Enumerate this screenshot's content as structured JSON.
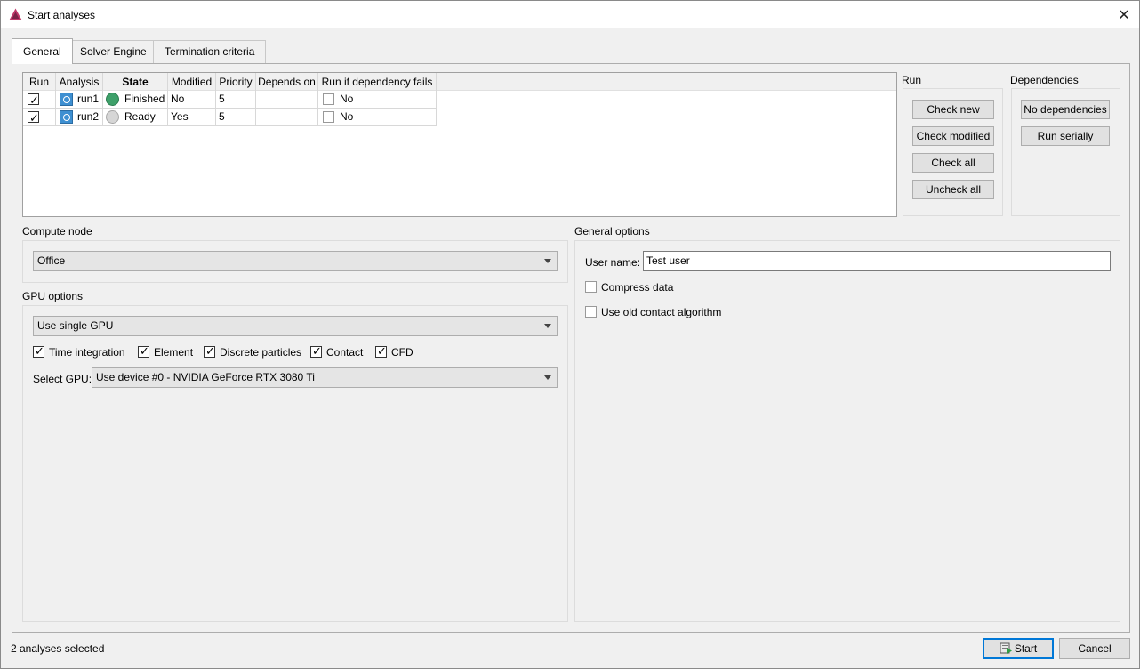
{
  "window": {
    "title": "Start analyses",
    "close_glyph": "✕"
  },
  "tabs": [
    {
      "label": "General",
      "active": true
    },
    {
      "label": "Solver Engine",
      "active": false
    },
    {
      "label": "Termination criteria",
      "active": false
    }
  ],
  "table": {
    "columns": [
      "Run",
      "Analysis",
      "State",
      "Modified",
      "Priority",
      "Depends on",
      "Run if dependency fails"
    ],
    "rows": [
      {
        "run_checked": true,
        "analysis": "run1",
        "state": "Finished",
        "state_color": "#3ea06a",
        "modified": "No",
        "priority": "5",
        "depends_on": "",
        "run_if_fails_checked": false,
        "run_if_fails": "No"
      },
      {
        "run_checked": true,
        "analysis": "run2",
        "state": "Ready",
        "state_color": "#d6d6d6",
        "modified": "Yes",
        "priority": "5",
        "depends_on": "",
        "run_if_fails_checked": false,
        "run_if_fails": "No"
      }
    ]
  },
  "run_group": {
    "label": "Run",
    "buttons": [
      "Check new",
      "Check modified",
      "Check all",
      "Uncheck all"
    ]
  },
  "dependencies_group": {
    "label": "Dependencies",
    "buttons": [
      "No dependencies",
      "Run serially"
    ]
  },
  "compute_node": {
    "label": "Compute node",
    "selected": "Office"
  },
  "gpu_options": {
    "label": "GPU options",
    "mode": "Use single GPU",
    "checkboxes": [
      {
        "label": "Time integration",
        "checked": true
      },
      {
        "label": "Element",
        "checked": true
      },
      {
        "label": "Discrete particles",
        "checked": true
      },
      {
        "label": "Contact",
        "checked": true
      },
      {
        "label": "CFD",
        "checked": true
      }
    ],
    "select_gpu_label": "Select GPU:",
    "select_gpu_value": "Use device #0 - NVIDIA GeForce RTX 3080 Ti"
  },
  "general_options": {
    "label": "General options",
    "user_name_label": "User name:",
    "user_name_value": "Test user",
    "compress_data": {
      "label": "Compress data",
      "checked": false
    },
    "old_contact": {
      "label": "Use old contact algorithm",
      "checked": false
    }
  },
  "footer": {
    "status": "2 analyses selected",
    "start_label": "Start",
    "cancel_label": "Cancel"
  },
  "colors": {
    "accent": "#0078d7",
    "finished": "#3ea06a",
    "ready": "#d6d6d6",
    "app_icon": "#c0396b"
  }
}
